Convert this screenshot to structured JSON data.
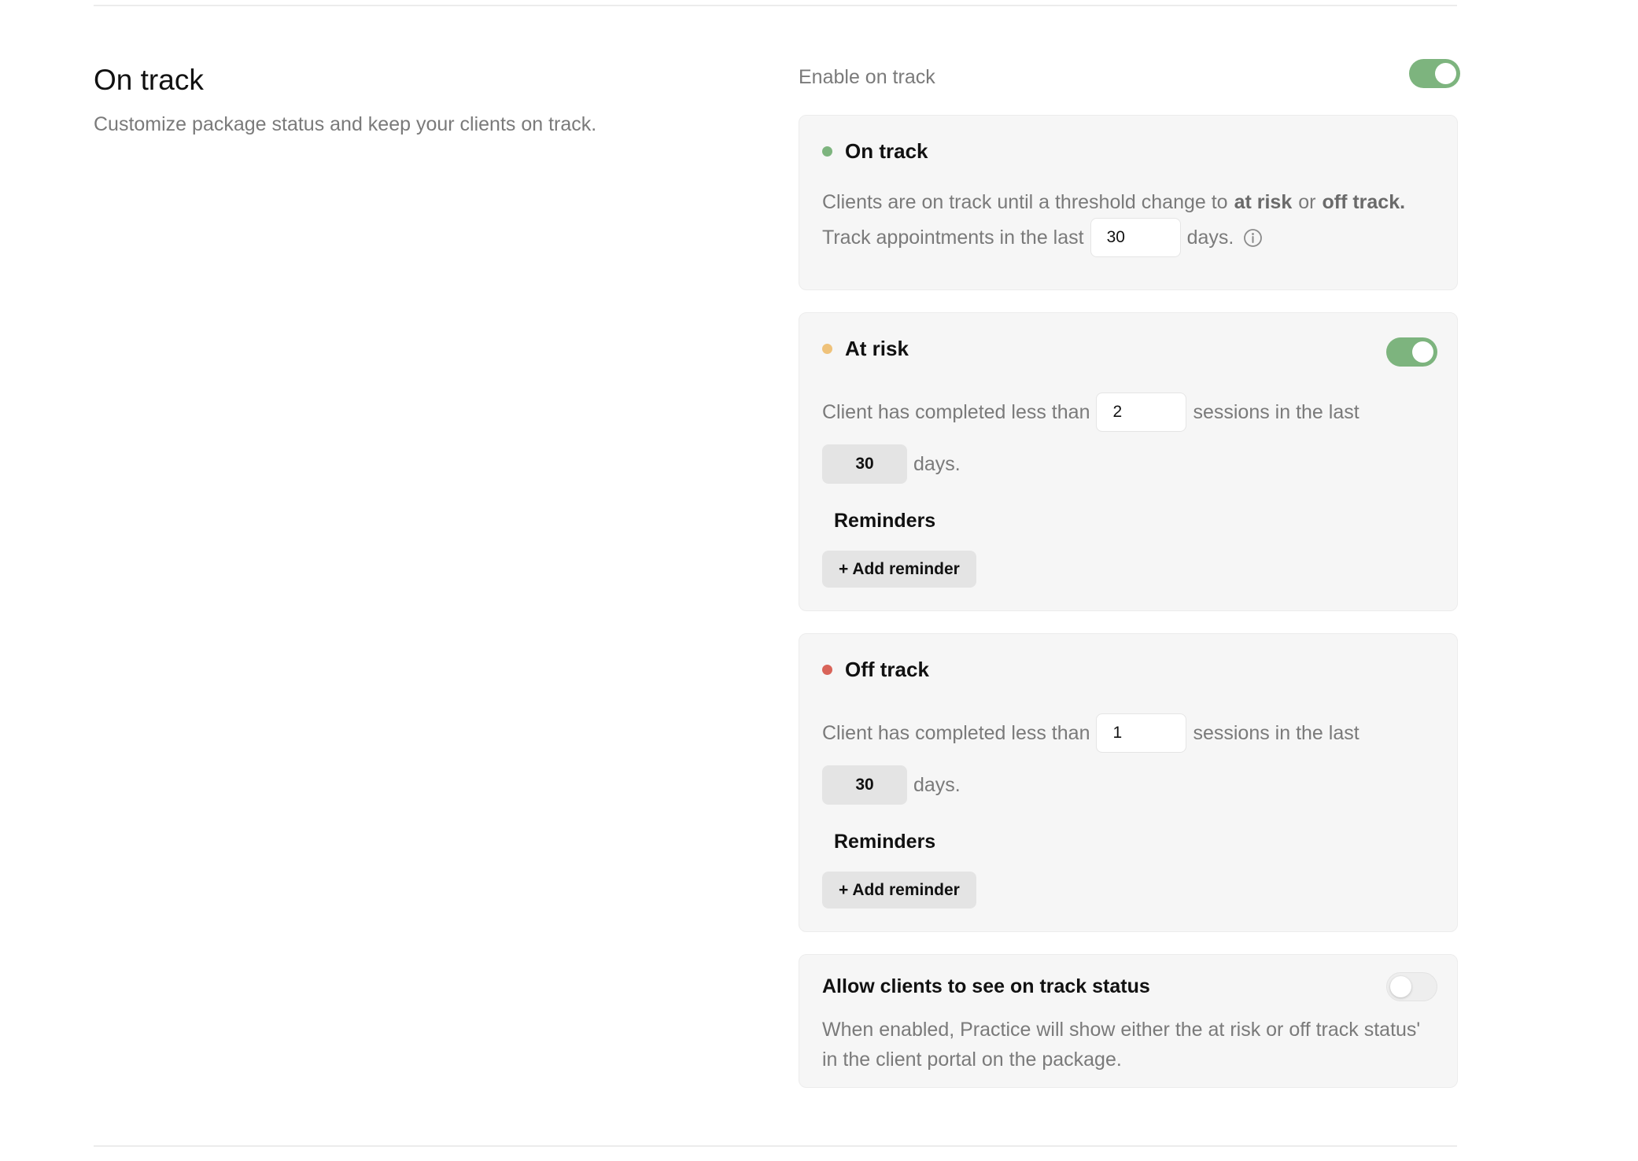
{
  "section": {
    "title": "On track",
    "subtitle": "Customize package status and keep your clients on track."
  },
  "enable": {
    "label": "Enable on track",
    "enabled": true
  },
  "on_track": {
    "title": "On track",
    "color": "#7db47e",
    "desc_part1": "Clients are on track until a threshold change to",
    "desc_at_risk": "at risk",
    "desc_or": "or",
    "desc_off_track": "off track.",
    "track_label": "Track appointments in the last",
    "track_days": "30",
    "days_suffix": "days.",
    "info_icon": "info-icon"
  },
  "at_risk": {
    "title": "At risk",
    "color": "#efc27a",
    "enabled": true,
    "completed_label": "Client has completed less than",
    "sessions": "2",
    "sessions_label": "sessions in the last",
    "days": "30",
    "days_suffix": "days.",
    "reminders_title": "Reminders",
    "add_reminder": "+ Add reminder"
  },
  "off_track": {
    "title": "Off track",
    "color": "#d96459",
    "completed_label": "Client has completed less than",
    "sessions": "1",
    "sessions_label": "sessions in the last",
    "days": "30",
    "days_suffix": "days.",
    "reminders_title": "Reminders",
    "add_reminder": "+ Add reminder"
  },
  "client_visibility": {
    "title": "Allow clients to see on track status",
    "description": "When enabled, Practice will show either the at risk or off track status' in the client portal on the package.",
    "enabled": false
  }
}
